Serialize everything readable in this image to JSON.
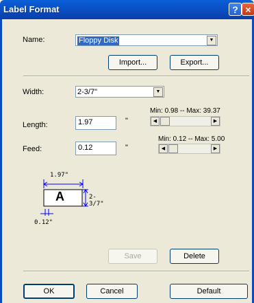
{
  "window": {
    "title": "Label Format",
    "help_glyph": "?",
    "close_glyph": "×"
  },
  "name_row": {
    "label": "Name:",
    "value": "Floppy Disk"
  },
  "buttons": {
    "import": "Import...",
    "export": "Export...",
    "save": "Save",
    "delete": "Delete",
    "ok": "OK",
    "cancel": "Cancel",
    "default": "Default"
  },
  "width_row": {
    "label": "Width:",
    "value": "2-3/7\""
  },
  "length_row": {
    "label": "Length:",
    "value": "1.97",
    "unit": "\"",
    "range": "Min: 0.98 -- Max: 39.37"
  },
  "feed_row": {
    "label": "Feed:",
    "value": "0.12",
    "unit": "\"",
    "range": "Min: 0.12 -- Max: 5.00"
  },
  "diagram": {
    "length_text": "1.97\"",
    "width_text": "2-3/7\"",
    "label_letter": "A",
    "feed_text": "0.12\""
  },
  "colors": {
    "titlebar": "#0a4bc0",
    "dialog_bg": "#ece9d8",
    "selection": "#316ac5",
    "dimension_line": "#0000ff"
  }
}
